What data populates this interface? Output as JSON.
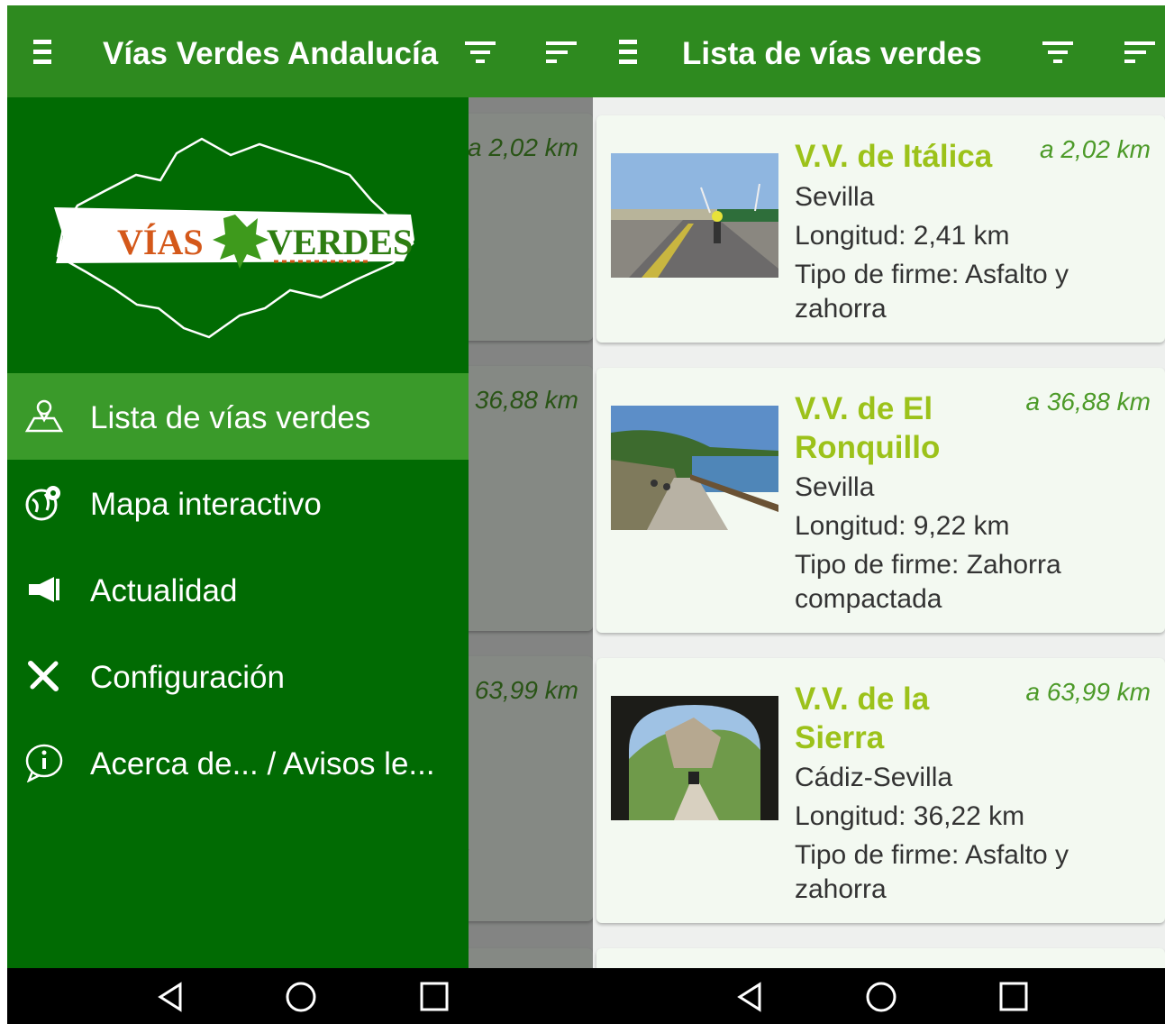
{
  "colors": {
    "appbar": "#2e8a1f",
    "drawer": "#016b03",
    "active_item": "#3a9a2a",
    "name": "#9cc21a",
    "distance": "#4c9a28"
  },
  "left": {
    "title": "Vías Verdes Andalucía",
    "logo_text": {
      "left": "VÍAS",
      "right": "VERDES"
    },
    "menu": [
      {
        "label": "Lista de vías verdes",
        "icon": "map-pin-icon",
        "active": true
      },
      {
        "label": "Mapa interactivo",
        "icon": "globe-pin-icon",
        "active": false
      },
      {
        "label": "Actualidad",
        "icon": "megaphone-icon",
        "active": false
      },
      {
        "label": "Configuración",
        "icon": "tools-icon",
        "active": false
      },
      {
        "label": "Acerca de... / Avisos le...",
        "icon": "info-bubble-icon",
        "active": false
      }
    ]
  },
  "right": {
    "title": "Lista de vías verdes",
    "items": [
      {
        "name": "V.V. de Itálica",
        "distance": "a  2,02 km",
        "province": "Sevilla",
        "length": "Longitud:  2,41 km",
        "surface1": "Tipo de firme: Asfalto y",
        "surface2": "zahorra"
      },
      {
        "name": "V.V. de El Ronquillo",
        "distance": "a 36,88 km",
        "province": "Sevilla",
        "length": "Longitud:  9,22 km",
        "surface1": "Tipo de firme: Zahorra",
        "surface2": "compactada"
      },
      {
        "name": "V.V. de la Sierra",
        "distance": "a 63,99 km",
        "province": "Cádiz-Sevilla",
        "length": "Longitud: 36,22 km",
        "surface1": "Tipo de firme: Asfalto y",
        "surface2": "zahorra"
      }
    ]
  }
}
